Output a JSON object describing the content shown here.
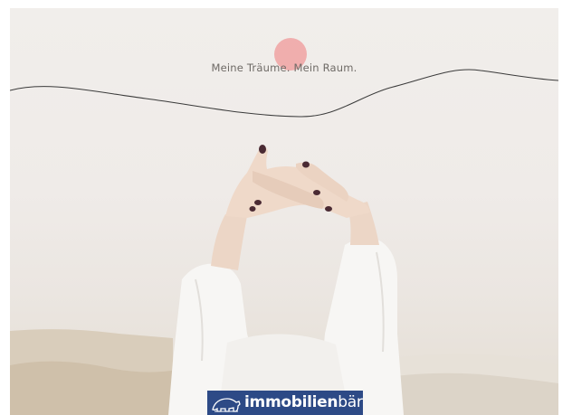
{
  "hero": {
    "tagline": "Meine Träume. Mein Raum."
  },
  "logo": {
    "text_bold": "immobilien",
    "text_light": "bär"
  },
  "colors": {
    "background": "#efebe8",
    "cursor_dot": "#f09696",
    "logo_background": "#2d4a86",
    "wave_line": "#3a3a3a"
  },
  "icons": {
    "logo_mark": "bear-icon"
  }
}
